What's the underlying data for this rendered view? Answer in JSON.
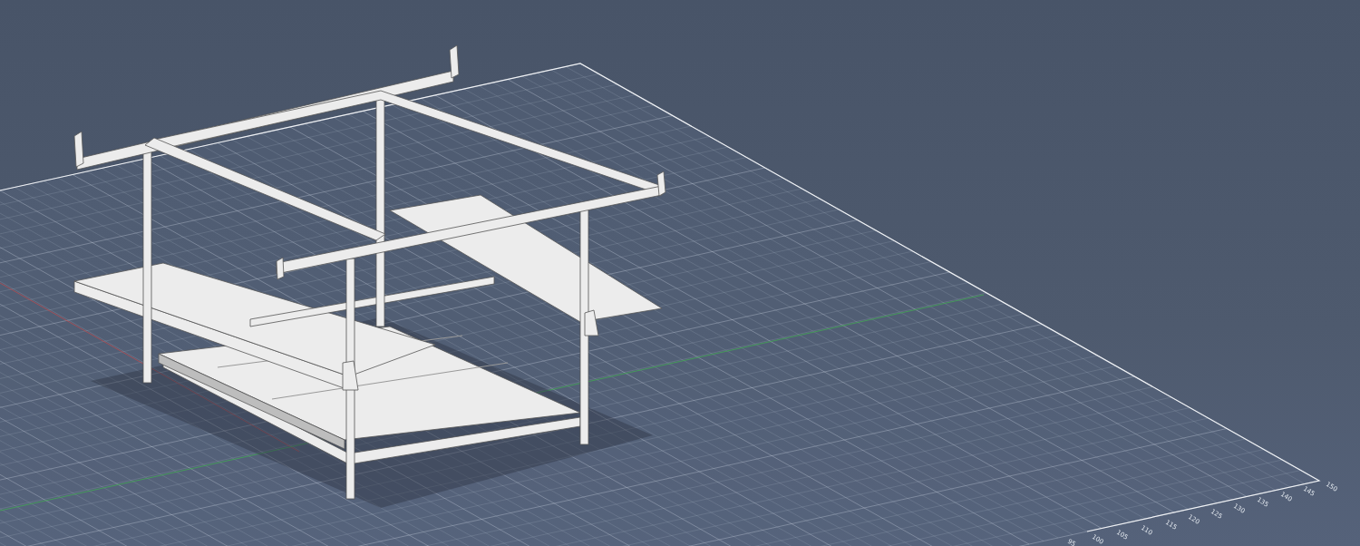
{
  "viewport": {
    "grid": {
      "tick_labels": [
        "95",
        "100",
        "105",
        "110",
        "115",
        "120",
        "125",
        "130",
        "135",
        "140",
        "145",
        "150"
      ]
    }
  }
}
